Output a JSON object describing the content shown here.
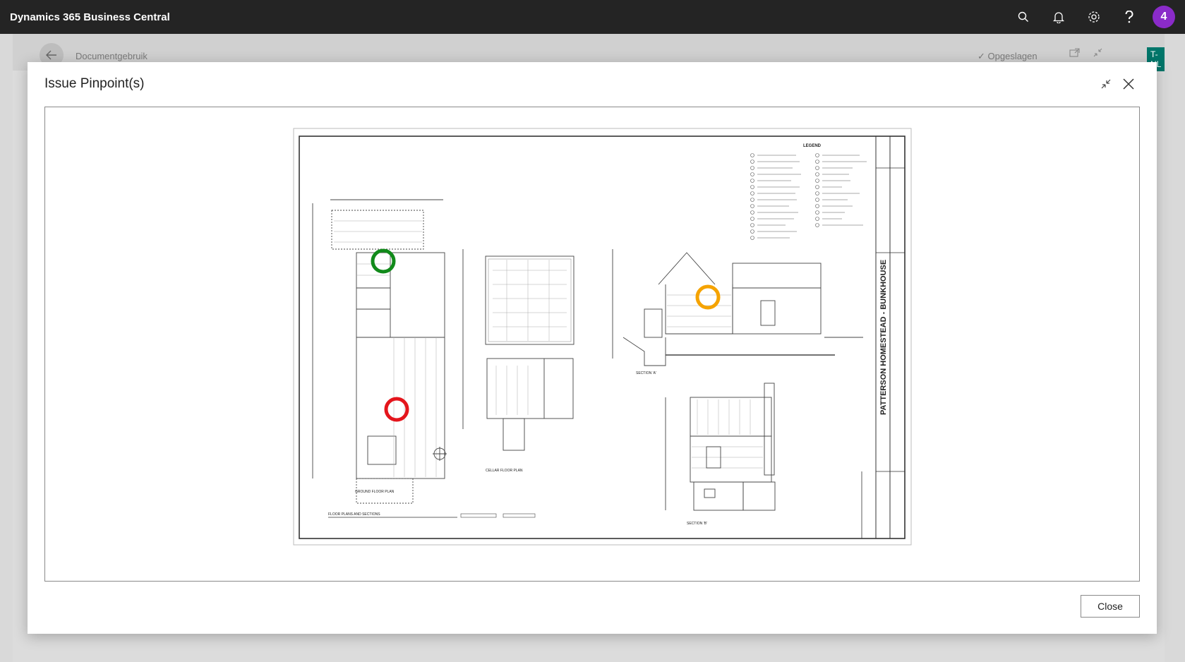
{
  "app": {
    "title": "Dynamics 365 Business Central",
    "avatar_label": "4"
  },
  "icons": {
    "search": "search-icon",
    "bell": "bell-icon",
    "settings": "gear-icon",
    "help": "help-icon"
  },
  "background_page": {
    "title": "Documentgebruik",
    "saved_label": "Opgeslagen",
    "badge": "T-NL"
  },
  "dialog": {
    "title": "Issue Pinpoint(s)",
    "close_button": "Close"
  },
  "drawing": {
    "legend_title": "LEGEND",
    "title_block": "PATTERSON HOMESTEAD - BUNKHOUSE",
    "sheet_title": "FLOOR PLANS AND SECTIONS",
    "plan_labels": [
      "GROUND FLOOR PLAN",
      "CELLAR FLOOR PLAN",
      "SECTION 'A'",
      "SECTION 'B'"
    ],
    "pinpoints": [
      {
        "name": "pinpoint-green",
        "color": "#118a1a"
      },
      {
        "name": "pinpoint-orange",
        "color": "#f5a300"
      },
      {
        "name": "pinpoint-red",
        "color": "#e4151c"
      }
    ]
  },
  "colors": {
    "appbar": "#242424",
    "avatar": "#8a2bc9",
    "badge": "#00766a"
  }
}
